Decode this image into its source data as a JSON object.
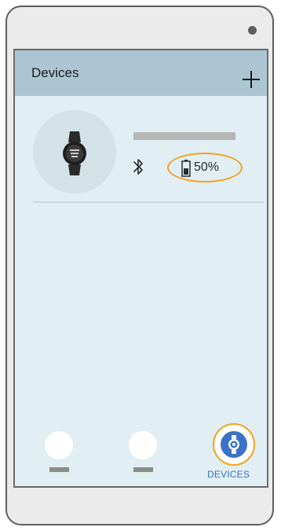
{
  "header": {
    "title": "Devices"
  },
  "device": {
    "battery_text": "50%",
    "battery_level": 0.5,
    "connection": "bluetooth"
  },
  "bottom_nav": {
    "items": [
      {
        "id": "tab-1",
        "label": "",
        "active": false
      },
      {
        "id": "tab-2",
        "label": "",
        "active": false
      },
      {
        "id": "devices",
        "label": "DEVICES",
        "active": true,
        "icon": "watch-icon"
      }
    ]
  },
  "colors": {
    "header_bg": "#acc5d3",
    "screen_bg": "#e1eef3",
    "highlight_ring": "#f3a21c",
    "accent_blue": "#3a73c6"
  }
}
